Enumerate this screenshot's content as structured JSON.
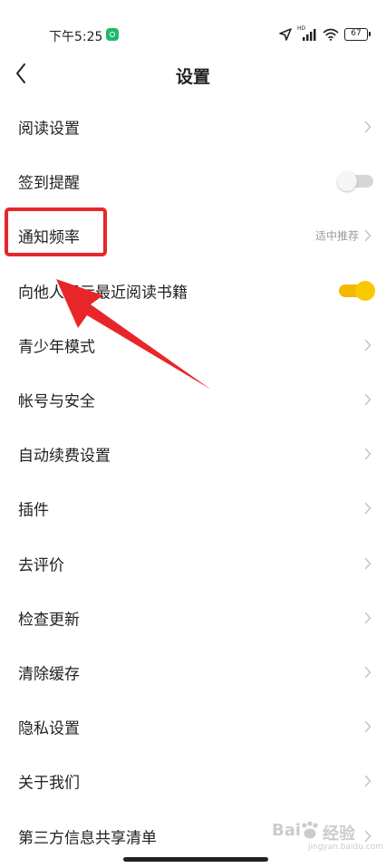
{
  "status_bar": {
    "time": "下午5:25",
    "signal_label": "HD",
    "battery": "67"
  },
  "nav": {
    "title": "设置"
  },
  "settings": [
    {
      "label": "阅读设置",
      "control": "chevron"
    },
    {
      "label": "签到提醒",
      "control": "toggle",
      "on": false
    },
    {
      "label": "通知频率",
      "control": "chevron",
      "value": "适中推荐"
    },
    {
      "label": "向他人展示最近阅读书籍",
      "control": "toggle",
      "on": true
    },
    {
      "label": "青少年模式",
      "control": "chevron"
    },
    {
      "label": "帐号与安全",
      "control": "chevron"
    },
    {
      "label": "自动续费设置",
      "control": "chevron"
    },
    {
      "label": "插件",
      "control": "chevron"
    },
    {
      "label": "去评价",
      "control": "chevron"
    },
    {
      "label": "检查更新",
      "control": "chevron"
    },
    {
      "label": "清除缓存",
      "control": "chevron"
    },
    {
      "label": "隐私设置",
      "control": "chevron"
    },
    {
      "label": "关于我们",
      "control": "chevron"
    },
    {
      "label": "第三方信息共享清单",
      "control": "chevron"
    }
  ],
  "watermark": {
    "brand": "Bai",
    "brand_cn": "经验",
    "url": "jingyan.baidu.com"
  },
  "colors": {
    "accent": "#f5b800",
    "annotation": "#e8262a",
    "muted": "#999999"
  }
}
